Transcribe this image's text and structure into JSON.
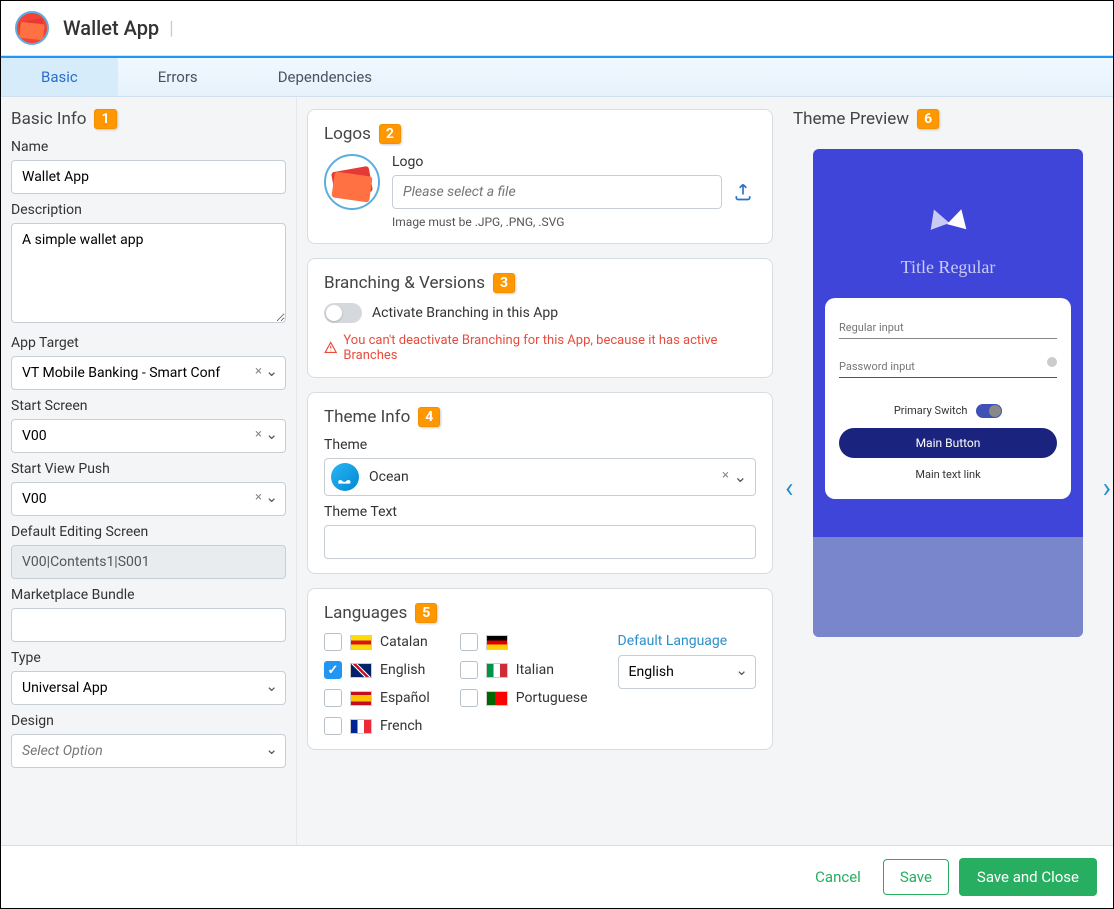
{
  "header": {
    "title": "Wallet App"
  },
  "tabs": [
    "Basic",
    "Errors",
    "Dependencies"
  ],
  "basicInfo": {
    "title": "Basic Info",
    "badge": "1",
    "nameLabel": "Name",
    "nameValue": "Wallet App",
    "descLabel": "Description",
    "descValue": "A simple wallet app",
    "appTargetLabel": "App Target",
    "appTargetValue": "VT Mobile Banking - Smart Conf",
    "startScreenLabel": "Start Screen",
    "startScreenValue": "V00",
    "startViewPushLabel": "Start View Push",
    "startViewPushValue": "V00",
    "defaultEditingScreenLabel": "Default Editing Screen",
    "defaultEditingScreenValue": "V00|Contents1|S001",
    "marketplaceBundleLabel": "Marketplace Bundle",
    "marketplaceBundleValue": "",
    "typeLabel": "Type",
    "typeValue": "Universal App",
    "designLabel": "Design",
    "designPlaceholder": "Select Option"
  },
  "logos": {
    "title": "Logos",
    "badge": "2",
    "logoLabel": "Logo",
    "filePlaceholder": "Please select a file",
    "hint": "Image must be .JPG, .PNG, .SVG"
  },
  "branching": {
    "title": "Branching & Versions",
    "badge": "3",
    "toggleLabel": "Activate Branching in this App",
    "warning": "You can't deactivate Branching for this App, because it has active Branches"
  },
  "themeInfo": {
    "title": "Theme Info",
    "badge": "4",
    "themeLabel": "Theme",
    "themeValue": "Ocean",
    "themeTextLabel": "Theme Text",
    "themeTextValue": ""
  },
  "languages": {
    "title": "Languages",
    "badge": "5",
    "items": [
      {
        "label": "Catalan",
        "checked": false,
        "flag": "ca"
      },
      {
        "label": "English",
        "checked": true,
        "flag": "en"
      },
      {
        "label": "Español",
        "checked": false,
        "flag": "es"
      },
      {
        "label": "French",
        "checked": false,
        "flag": "fr"
      },
      {
        "label": "",
        "checked": false,
        "flag": "de"
      },
      {
        "label": "Italian",
        "checked": false,
        "flag": "it"
      },
      {
        "label": "Portuguese",
        "checked": false,
        "flag": "pt"
      }
    ],
    "defaultLangLabel": "Default Language",
    "defaultLangValue": "English"
  },
  "preview": {
    "title": "Theme Preview",
    "badge": "6",
    "phoneTitle": "Title Regular",
    "regularInput": "Regular input",
    "passwordInput": "Password input",
    "switchLabel": "Primary Switch",
    "mainButton": "Main Button",
    "mainLink": "Main text link"
  },
  "footer": {
    "cancel": "Cancel",
    "save": "Save",
    "saveClose": "Save and Close"
  }
}
